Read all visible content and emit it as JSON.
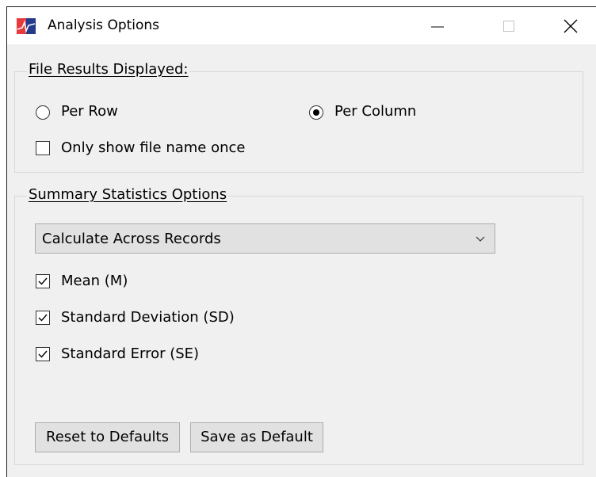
{
  "window": {
    "title": "Analysis Options",
    "icon": "app-waveform-icon",
    "controls": [
      "minimize-icon",
      "maximize-icon",
      "close-icon"
    ]
  },
  "file_results": {
    "group_title": "File Results Displayed:",
    "radio_per_row": {
      "label": "Per Row",
      "selected": false
    },
    "radio_per_column": {
      "label": "Per Column",
      "selected": true
    },
    "only_show_file_name_once": {
      "label": "Only show file name once",
      "checked": false
    }
  },
  "summary_statistics": {
    "group_title": "Summary Statistics Options",
    "calculation_mode": {
      "selected": "Calculate Across Records"
    },
    "mean": {
      "label": "Mean (M)",
      "checked": true
    },
    "standard_deviation": {
      "label": "Standard Deviation (SD)",
      "checked": true
    },
    "standard_error": {
      "label": "Standard Error (SE)",
      "checked": true
    }
  },
  "buttons": {
    "reset_label": "Reset to Defaults",
    "save_label": "Save as Default"
  },
  "colors": {
    "dialog_background": "#f0f0f0",
    "titlebar_background": "#ffffff",
    "button_face": "#e1e1e1",
    "button_border": "#adadad",
    "icon_red": "#e8393d",
    "icon_navy": "#253a8a"
  }
}
